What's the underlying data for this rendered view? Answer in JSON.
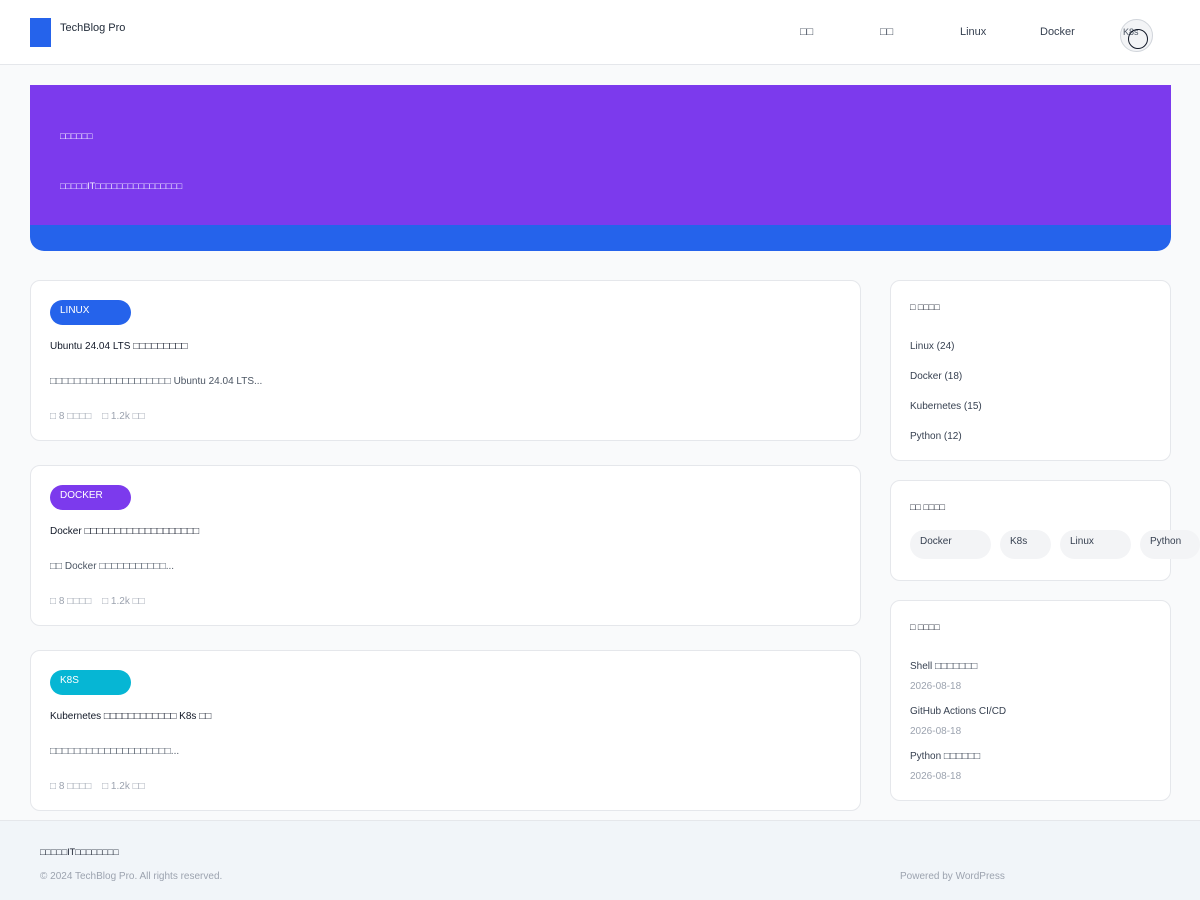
{
  "header": {
    "site_title": "TechBlog Pro",
    "nav": [
      {
        "label": "□□"
      },
      {
        "label": "□□"
      },
      {
        "label": "Linux"
      },
      {
        "label": "Docker"
      }
    ],
    "nav_button_label": "K8s"
  },
  "hero": {
    "title": "□□□□□□",
    "subtitle": "□□□□□IT□□□□□□□□□□□□□□□□"
  },
  "posts": [
    {
      "badge": "LINUX",
      "badge_color": "#2563eb",
      "title": "Ubuntu 24.04 LTS □□□□□□□□□",
      "excerpt": "□□□□□□□□□□□□□□□□□□□□ Ubuntu 24.04 LTS...",
      "reading_time": "□ 8 □□□□",
      "views": "□ 1.2k □□"
    },
    {
      "badge": "DOCKER",
      "badge_color": "#7c3aed",
      "title": "Docker □□□□□□□□□□□□□□□□□□□",
      "excerpt": "□□ Docker □□□□□□□□□□□...",
      "reading_time": "□ 8 □□□□",
      "views": "□ 1.2k □□"
    },
    {
      "badge": "K8S",
      "badge_color": "#06b6d4",
      "title": "Kubernetes □□□□□□□□□□□□ K8s □□",
      "excerpt": "□□□□□□□□□□□□□□□□□□□□...",
      "reading_time": "□ 8 □□□□",
      "views": "□ 1.2k □□"
    }
  ],
  "sidebar": {
    "categories": {
      "title": "□ □□□□",
      "items": [
        "Linux (24)",
        "Docker (18)",
        "Kubernetes (15)",
        "Python (12)"
      ]
    },
    "tags": {
      "title": "□□ □□□□",
      "items": [
        "Docker",
        "K8s",
        "Linux",
        "Python"
      ]
    },
    "recent": {
      "title": "□ □□□□",
      "items": [
        {
          "title": "Shell □□□□□□□",
          "date": "2026-08-18"
        },
        {
          "title": "GitHub Actions CI/CD",
          "date": "2026-08-18"
        },
        {
          "title": "Python □□□□□□",
          "date": "2026-08-18"
        }
      ]
    }
  },
  "footer": {
    "tagline": "□□□□□IT□□□□□□□□",
    "copyright": "© 2024 TechBlog Pro. All rights reserved.",
    "powered_by": "Powered by WordPress"
  },
  "colors": {
    "primary": "#2563eb",
    "hero": "#7c3aed",
    "accent_cyan": "#06b6d4"
  }
}
